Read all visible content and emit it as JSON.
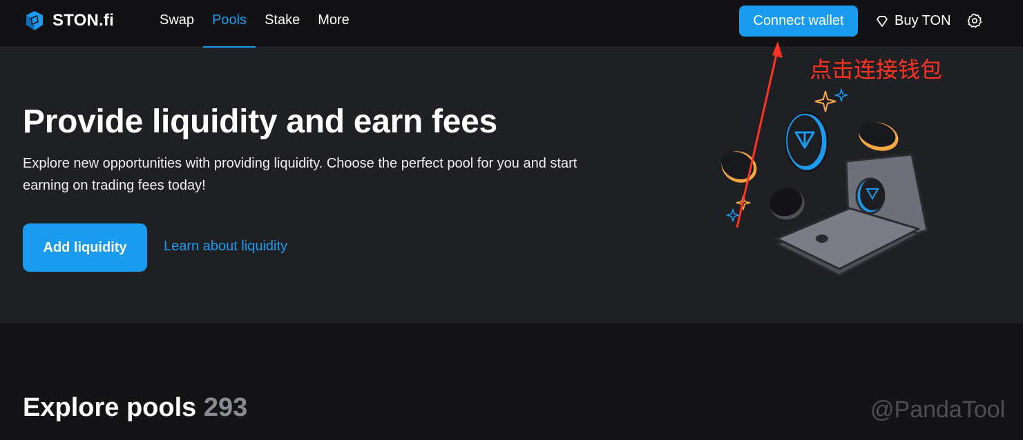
{
  "header": {
    "brand": "STON.fi",
    "nav": [
      {
        "label": "Swap",
        "active": false
      },
      {
        "label": "Pools",
        "active": true
      },
      {
        "label": "Stake",
        "active": false
      },
      {
        "label": "More",
        "active": false
      }
    ],
    "connect_wallet": "Connect wallet",
    "buy_ton": "Buy TON",
    "icons": {
      "logo": "ston-logo-icon",
      "buy": "diamond-icon",
      "settings": "gear-icon"
    }
  },
  "hero": {
    "title": "Provide liquidity and earn fees",
    "description": "Explore new opportunities with providing liquidity. Choose the perfect pool for you and start earning on trading fees today!",
    "add_liquidity": "Add liquidity",
    "learn_link": "Learn about liquidity"
  },
  "explore": {
    "title": "Explore pools",
    "count": "293"
  },
  "annotation": {
    "text": "点击连接钱包",
    "color": "#ff3322"
  },
  "watermark": "@PandaTool",
  "colors": {
    "accent": "#1a9bf0",
    "header_bg": "#121214",
    "hero_bg": "#1f2023",
    "page_bg": "#141417",
    "coin_gold": "#f5a742"
  }
}
